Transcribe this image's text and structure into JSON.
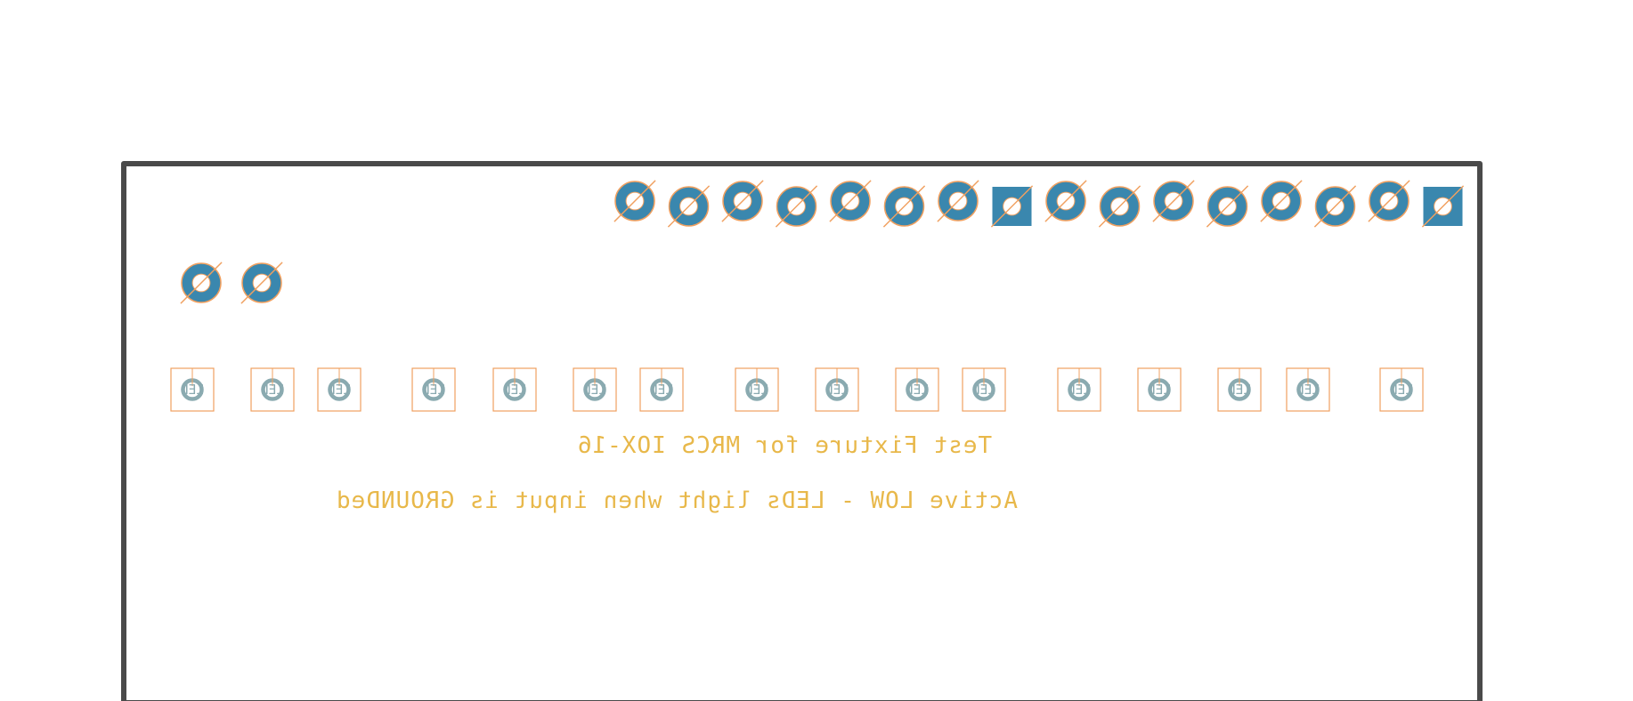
{
  "colors": {
    "outline": "#4a4a4a",
    "pad": "#3a87ae",
    "pad_ring": "#f0a060",
    "silkscreen": "#e8b84a",
    "led_outline": "#f0a060",
    "led_pad": "#8aaab0"
  },
  "header_pins": {
    "count": 16,
    "square_pins": [
      8,
      16
    ]
  },
  "power_pins": {
    "count": 2
  },
  "leds": {
    "count": 16,
    "label": "LED"
  },
  "silkscreen": {
    "line1": "Test Fixture for MRCS IOX-16",
    "line2": "Active LOW - LEDs light when input is GROUNDed"
  }
}
